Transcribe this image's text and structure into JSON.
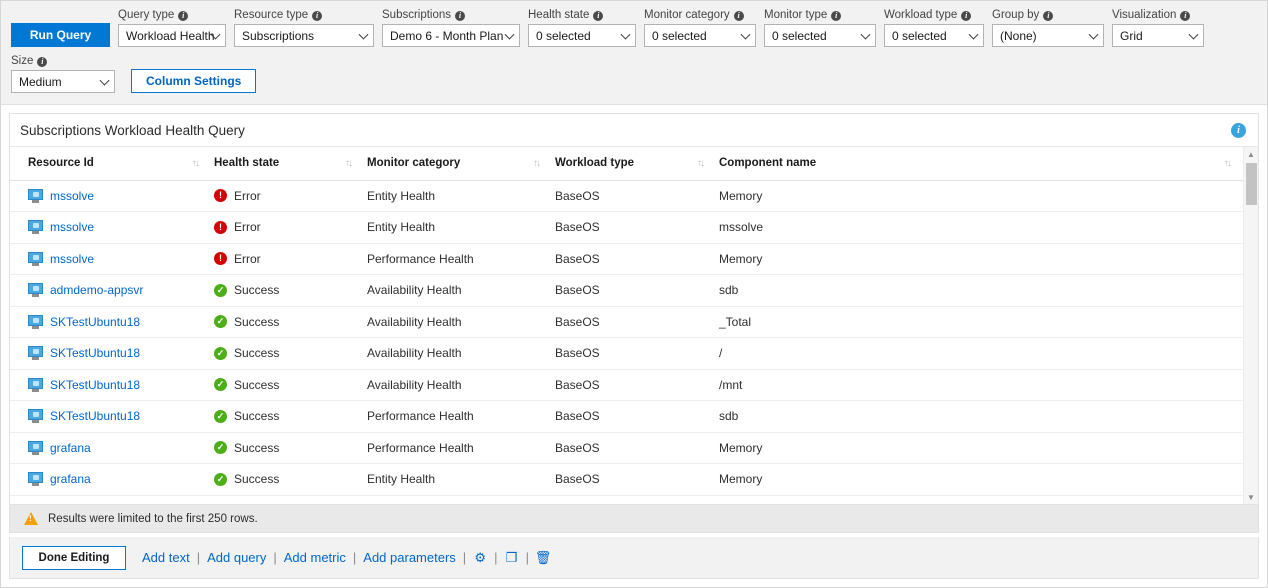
{
  "toolbar": {
    "run_query_label": "Run Query",
    "column_settings_label": "Column Settings",
    "fields": [
      {
        "label": "Query type",
        "value": "Workload Health"
      },
      {
        "label": "Resource type",
        "value": "Subscriptions"
      },
      {
        "label": "Subscriptions",
        "value": "Demo 6 - Month Plan"
      },
      {
        "label": "Health state",
        "value": "0 selected"
      },
      {
        "label": "Monitor category",
        "value": "0 selected"
      },
      {
        "label": "Monitor type",
        "value": "0 selected"
      },
      {
        "label": "Workload type",
        "value": "0 selected"
      },
      {
        "label": "Group by",
        "value": "(None)"
      },
      {
        "label": "Visualization",
        "value": "Grid"
      }
    ],
    "size_field": {
      "label": "Size",
      "value": "Medium"
    }
  },
  "panel": {
    "title": "Subscriptions Workload Health Query",
    "info_icon": "info-icon",
    "info_glyph": "i"
  },
  "table": {
    "columns": [
      {
        "key": "resource_id",
        "label": "Resource Id"
      },
      {
        "key": "health_state",
        "label": "Health state"
      },
      {
        "key": "monitor_category",
        "label": "Monitor category"
      },
      {
        "key": "workload_type",
        "label": "Workload type"
      },
      {
        "key": "component_name",
        "label": "Component name"
      }
    ],
    "sort_glyph": "↑↓",
    "rows": [
      {
        "resource_id": "mssolve",
        "health_state": "Error",
        "monitor_category": "Entity Health",
        "workload_type": "BaseOS",
        "component_name": "Memory"
      },
      {
        "resource_id": "mssolve",
        "health_state": "Error",
        "monitor_category": "Entity Health",
        "workload_type": "BaseOS",
        "component_name": "mssolve"
      },
      {
        "resource_id": "mssolve",
        "health_state": "Error",
        "monitor_category": "Performance Health",
        "workload_type": "BaseOS",
        "component_name": "Memory"
      },
      {
        "resource_id": "admdemo-appsvr",
        "health_state": "Success",
        "monitor_category": "Availability Health",
        "workload_type": "BaseOS",
        "component_name": "sdb"
      },
      {
        "resource_id": "SKTestUbuntu18",
        "health_state": "Success",
        "monitor_category": "Availability Health",
        "workload_type": "BaseOS",
        "component_name": "_Total"
      },
      {
        "resource_id": "SKTestUbuntu18",
        "health_state": "Success",
        "monitor_category": "Availability Health",
        "workload_type": "BaseOS",
        "component_name": "/"
      },
      {
        "resource_id": "SKTestUbuntu18",
        "health_state": "Success",
        "monitor_category": "Availability Health",
        "workload_type": "BaseOS",
        "component_name": "/mnt"
      },
      {
        "resource_id": "SKTestUbuntu18",
        "health_state": "Success",
        "monitor_category": "Performance Health",
        "workload_type": "BaseOS",
        "component_name": "sdb"
      },
      {
        "resource_id": "grafana",
        "health_state": "Success",
        "monitor_category": "Performance Health",
        "workload_type": "BaseOS",
        "component_name": "Memory"
      },
      {
        "resource_id": "grafana",
        "health_state": "Success",
        "monitor_category": "Entity Health",
        "workload_type": "BaseOS",
        "component_name": "Memory"
      }
    ],
    "state_colors": {
      "error": "#d40000",
      "success": "#4caf18"
    },
    "error_glyph": "!",
    "success_glyph": "✓"
  },
  "warning": {
    "text": "Results were limited to the first 250 rows."
  },
  "footer": {
    "done_editing_label": "Done Editing",
    "links": [
      "Add text",
      "Add query",
      "Add metric",
      "Add parameters"
    ],
    "separator": "|",
    "icons": [
      {
        "name": "gear-icon",
        "glyph": "⚙"
      },
      {
        "name": "copy-icon",
        "glyph": "❐"
      },
      {
        "name": "trash-icon",
        "glyph": "🗑"
      }
    ]
  }
}
